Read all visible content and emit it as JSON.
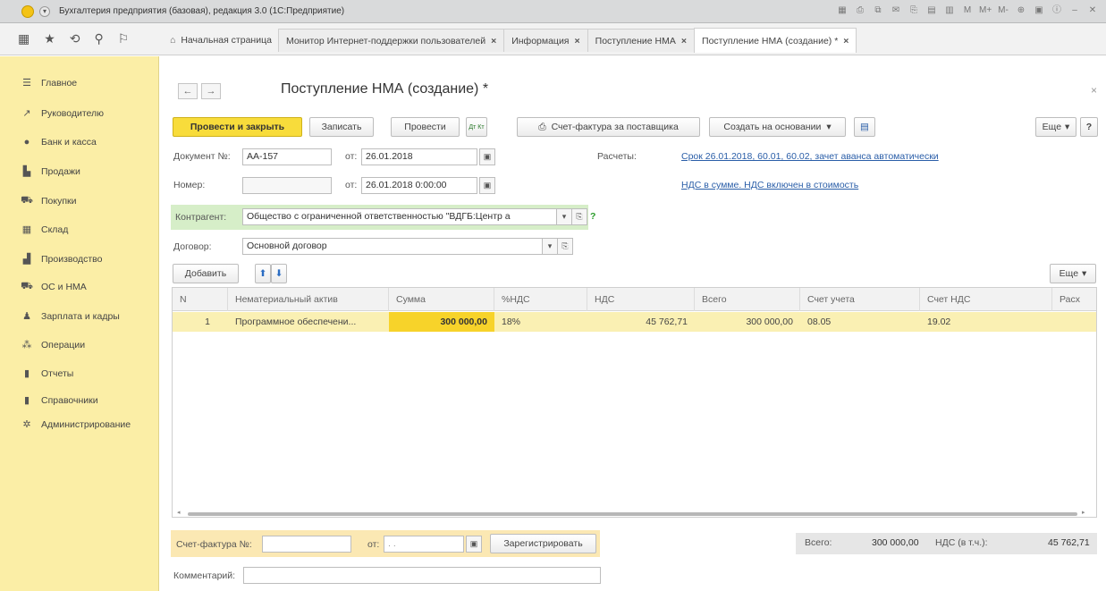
{
  "window": {
    "title": "Бухгалтерия предприятия (базовая), редакция 3.0  (1С:Предприятие)",
    "menu_glyph": "▾",
    "tools": [
      "▦",
      "⎙",
      "⧉",
      "✉",
      "⎘",
      "▤",
      "▥",
      "M",
      "M+",
      "M-",
      "⊕",
      "▣",
      "ⓘ",
      "–",
      "✕"
    ]
  },
  "toolbar_icons": [
    "▦",
    "★",
    "⟲",
    "⚲",
    "⚐"
  ],
  "tabs": [
    {
      "label": "Начальная страница",
      "close": "",
      "home": true
    },
    {
      "label": "Монитор Интернет-поддержки пользователей",
      "close": "×"
    },
    {
      "label": "Информация",
      "close": "×"
    },
    {
      "label": "Поступление НМА",
      "close": "×"
    },
    {
      "label": "Поступление НМА (создание) *",
      "close": "×",
      "active": true
    }
  ],
  "home_icon": "⌂",
  "sidebar": {
    "items": [
      {
        "label": "Главное",
        "icon": "☰"
      },
      {
        "label": "Руководителю",
        "icon": "↗"
      },
      {
        "label": "Банк и касса",
        "icon": "●"
      },
      {
        "label": "Продажи",
        "icon": "▙"
      },
      {
        "label": "Покупки",
        "icon": "⛟"
      },
      {
        "label": "Склад",
        "icon": "▦"
      },
      {
        "label": "Производство",
        "icon": "▟"
      },
      {
        "label": "ОС и НМА",
        "icon": "⛟"
      },
      {
        "label": "Зарплата и кадры",
        "icon": "♟"
      },
      {
        "label": "Операции",
        "icon": "⁂"
      },
      {
        "label": "Отчеты",
        "icon": "▮"
      },
      {
        "label": "Справочники",
        "icon": "▮"
      },
      {
        "label": "Администрирование",
        "icon": "✲"
      }
    ]
  },
  "form": {
    "title": "Поступление НМА (создание) *",
    "back": "←",
    "forward": "→",
    "close": "×",
    "buttons": {
      "post_and_close": "Провести и закрыть",
      "save": "Записать",
      "post": "Провести",
      "dt_kt": "Дт Кт",
      "invoice_from_supplier": "Счет-фактура за поставщика",
      "printer_icon": "⎙",
      "create_based_on": "Создать на основании",
      "dropdown": "▾",
      "report_icon": "▤",
      "more": "Еще",
      "help": "?"
    },
    "doc_number_label": "Документ №:",
    "doc_number": "АА-157",
    "from_label": "от:",
    "doc_date": "26.01.2018",
    "number_label": "Номер:",
    "number_value": "",
    "from_label2": "от:",
    "number_date": "26.01.2018  0:00:00",
    "calendar_icon": "▣",
    "settlements_label": "Расчеты:",
    "settlements_link": "Срок 26.01.2018, 60.01, 60.02, зачет аванса автоматически",
    "vat_link": "НДС в сумме. НДС включен в стоимость",
    "counterparty_label": "Контрагент:",
    "counterparty": "Общество с ограниченной ответственностью \"ВДГБ:Центр а",
    "contract_label": "Договор:",
    "contract": "Основной договор",
    "open_icon": "⎘",
    "help_q": "?"
  },
  "table": {
    "add_button": "Добавить",
    "up_icon": "⬆",
    "down_icon": "⬇",
    "more": "Еще",
    "columns": [
      "N",
      "Нематериальный актив",
      "Сумма",
      "%НДС",
      "НДС",
      "Всего",
      "Счет учета",
      "Счет НДС",
      "Расх"
    ],
    "rows": [
      {
        "n": "1",
        "asset": "Программное обеспечени...",
        "sum": "300 000,00",
        "vat_rate": "18%",
        "vat": "45 762,71",
        "total": "300 000,00",
        "account": "08.05",
        "vat_account": "19.02",
        "exp": ""
      }
    ]
  },
  "footer": {
    "invoice_label": "Счет-фактура №:",
    "invoice_no": "",
    "from_label": "от:",
    "invoice_date": ". .",
    "register": "Зарегистрировать",
    "total_label": "Всего:",
    "total_value": "300 000,00",
    "vat_label": "НДС (в т.ч.):",
    "vat_value": "45 762,71",
    "comment_label": "Комментарий:",
    "comment": ""
  }
}
